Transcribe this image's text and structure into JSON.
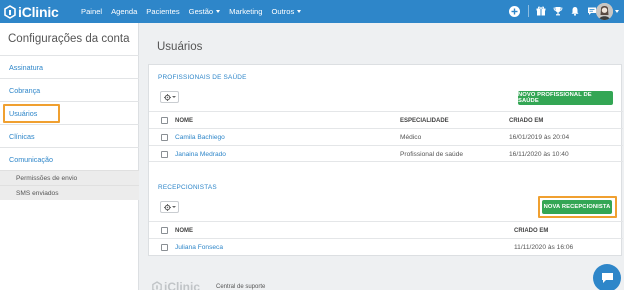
{
  "header": {
    "logo_text": "iClinic",
    "nav": [
      {
        "label": "Painel"
      },
      {
        "label": "Agenda"
      },
      {
        "label": "Pacientes"
      },
      {
        "label": "Gestão"
      },
      {
        "label": "Marketing"
      },
      {
        "label": "Outros"
      }
    ],
    "icons": [
      "plus-icon",
      "gift-icon",
      "trophy-icon",
      "bell-icon",
      "chat-bubble-icon"
    ]
  },
  "sidebar": {
    "title": "Configurações da conta",
    "items": [
      {
        "label": "Assinatura"
      },
      {
        "label": "Cobrança"
      },
      {
        "label": "Usuários"
      },
      {
        "label": "Clínicas"
      },
      {
        "label": "Comunicação"
      }
    ],
    "subitems": [
      {
        "label": "Permissões de envio"
      },
      {
        "label": "SMS enviados"
      }
    ]
  },
  "main": {
    "title": "Usuários",
    "professionals": {
      "title": "PROFISSIONAIS DE SAÚDE",
      "new_button": "NOVO PROFISSIONAL DE SAÚDE",
      "columns": [
        "NOME",
        "ESPECIALIDADE",
        "CRIADO EM"
      ],
      "rows": [
        {
          "name": "Camila Bachiego",
          "specialty": "Médico",
          "created": "16/01/2019 às 20:04"
        },
        {
          "name": "Janaina Medrado",
          "specialty": "Profissional de saúde",
          "created": "16/11/2020 às 10:40"
        }
      ]
    },
    "receptionists": {
      "title": "RECEPCIONISTAS",
      "new_button": "NOVA RECEPCIONISTA",
      "columns": [
        "NOME",
        "CRIADO EM"
      ],
      "rows": [
        {
          "name": "Juliana Fonseca",
          "created": "11/11/2020 às 16:06"
        }
      ]
    }
  },
  "footer": {
    "logo_text": "iClinic",
    "support_link": "Central de suporte"
  },
  "colors": {
    "brand_blue": "#2e86c9",
    "action_green": "#33a654",
    "highlight_orange": "#f0a030"
  }
}
